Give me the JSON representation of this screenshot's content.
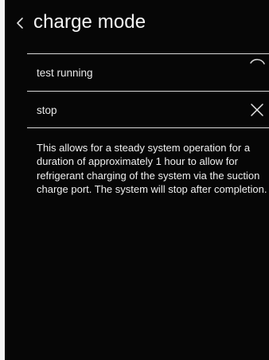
{
  "header": {
    "title": "charge mode",
    "back_icon": "chevron-left-icon"
  },
  "options": [
    {
      "label": "test running",
      "icon": "spinner-icon"
    },
    {
      "label": "stop",
      "icon": "close-icon"
    }
  ],
  "description": "This allows for a steady system operation for a duration of approximately 1 hour to allow for refrigerant charging of the system via the suction charge port. The system will stop after completion.",
  "colors": {
    "background": "#060606",
    "text": "#f2f2f2",
    "divider": "#d8d8d8"
  }
}
